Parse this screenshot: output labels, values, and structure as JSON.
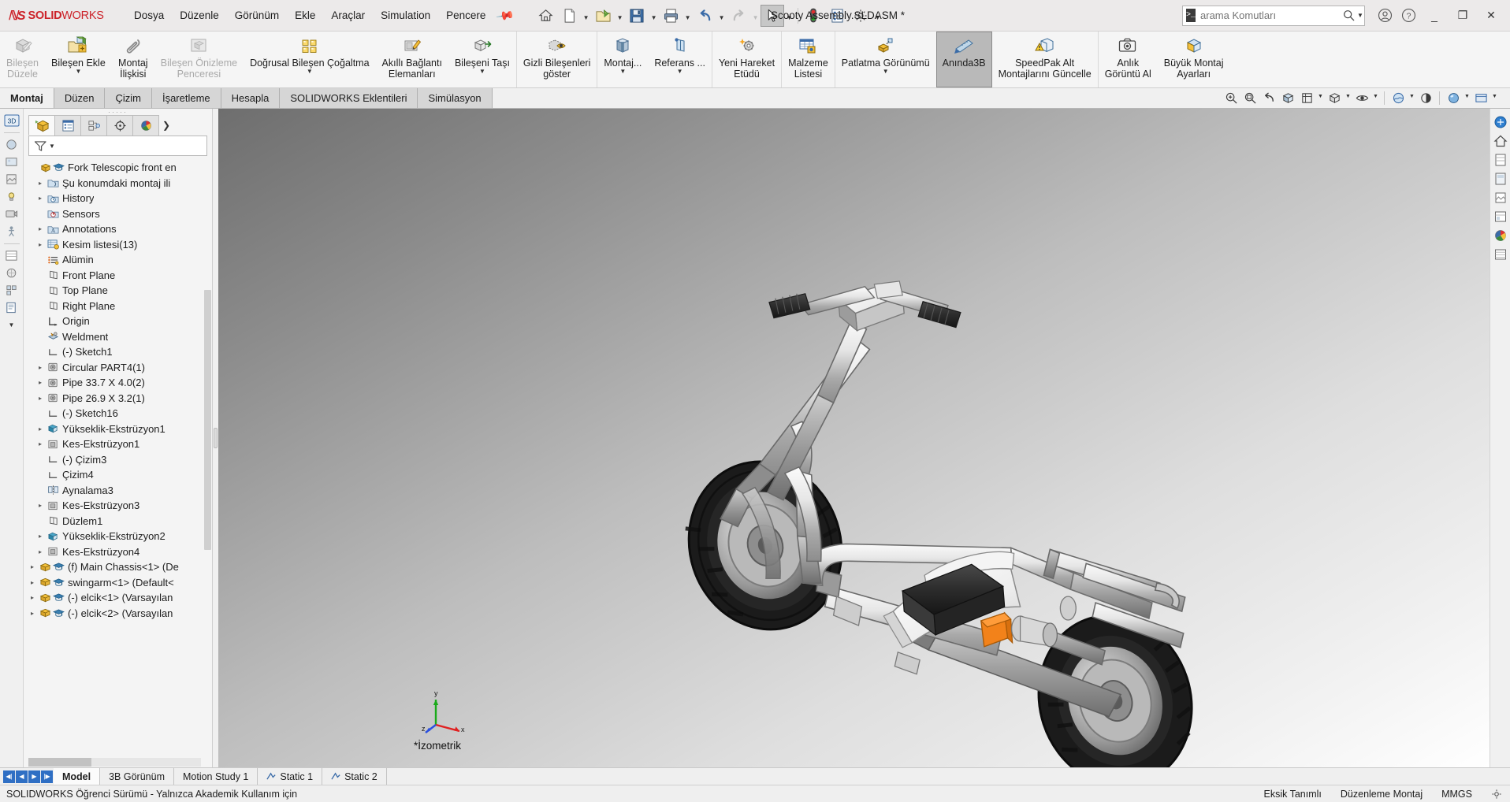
{
  "titlebar": {
    "brand_ds": "2S",
    "brand_solid": "SOLID",
    "brand_works": "WORKS",
    "menus": [
      "Dosya",
      "Düzenle",
      "Görünüm",
      "Ekle",
      "Araçlar",
      "Simulation",
      "Pencere"
    ],
    "pin_icon": "pin-icon",
    "quick_tools": [
      {
        "name": "home-icon"
      },
      {
        "name": "new-document-icon",
        "caret": true
      },
      {
        "name": "open-folder-icon",
        "caret": true
      },
      {
        "name": "save-icon",
        "caret": true
      },
      {
        "name": "print-icon",
        "caret": true
      },
      {
        "name": "undo-icon",
        "caret": true
      },
      {
        "name": "redo-icon",
        "caret": true,
        "disabled": true
      },
      {
        "name": "select-cursor-icon",
        "caret": true,
        "active": true
      },
      {
        "name": "rebuild-icon"
      },
      {
        "name": "file-properties-icon"
      },
      {
        "name": "options-gear-icon",
        "caret": true
      }
    ],
    "document_title": "Scooty Assembly.SLDASM *",
    "search_placeholder": "arama Komutları",
    "search_value": "",
    "account_icon": "user-account-icon",
    "help_icon": "help-question-icon",
    "minimize": "_",
    "restore": "❐",
    "close": "✕"
  },
  "ribbon": {
    "groups": [
      {
        "buttons": [
          {
            "label": "Bileşen\nDüzele",
            "icon": "edit-component-icon",
            "disabled": true,
            "caret": false
          },
          {
            "label": "Bileşen Ekle",
            "icon": "insert-component-icon",
            "disabled": false,
            "caret": true
          },
          {
            "label": "Montaj\nİlişkisi",
            "icon": "mate-paperclip-icon",
            "disabled": false,
            "caret": false
          },
          {
            "label": "Bileşen Önizleme\nPenceresi",
            "icon": "component-preview-icon",
            "disabled": true,
            "caret": false
          },
          {
            "label": "Doğrusal Bileşen Çoğaltma",
            "icon": "linear-pattern-icon",
            "disabled": false,
            "caret": true
          },
          {
            "label": "Akıllı Bağlantı\nElemanları",
            "icon": "smart-fasteners-icon",
            "disabled": false,
            "caret": false
          },
          {
            "label": "Bileşeni Taşı",
            "icon": "move-component-icon",
            "disabled": false,
            "caret": true
          }
        ]
      },
      {
        "buttons": [
          {
            "label": "Gizli Bileşenleri\ngöster",
            "icon": "show-hidden-components-icon",
            "disabled": false,
            "caret": false
          }
        ]
      },
      {
        "buttons": [
          {
            "label": "Montaj...",
            "icon": "assembly-features-icon",
            "disabled": false,
            "caret": true
          },
          {
            "label": "Referans ...",
            "icon": "reference-geometry-icon",
            "disabled": false,
            "caret": true
          }
        ]
      },
      {
        "buttons": [
          {
            "label": "Yeni Hareket\nEtüdü",
            "icon": "new-motion-study-icon",
            "disabled": false,
            "caret": false
          }
        ]
      },
      {
        "buttons": [
          {
            "label": "Malzeme\nListesi",
            "icon": "bill-of-materials-icon",
            "disabled": false,
            "caret": false
          }
        ]
      },
      {
        "buttons": [
          {
            "label": "Patlatma Görünümü",
            "icon": "exploded-view-icon",
            "disabled": false,
            "caret": true
          },
          {
            "label": "Anında3B",
            "icon": "instant3d-icon",
            "disabled": false,
            "caret": false,
            "selected": true
          },
          {
            "label": "SpeedPak Alt\nMontajlarını Güncelle",
            "icon": "speedpak-update-icon",
            "disabled": false,
            "caret": false
          }
        ]
      },
      {
        "buttons": [
          {
            "label": "Anlık\nGörüntü Al",
            "icon": "take-snapshot-camera-icon",
            "disabled": false,
            "caret": false
          },
          {
            "label": "Büyük Montaj\nAyarları",
            "icon": "large-assembly-settings-icon",
            "disabled": false,
            "caret": false
          }
        ]
      }
    ]
  },
  "tabs": {
    "items": [
      "Montaj",
      "Düzen",
      "Çizim",
      "İşaretleme",
      "Hesapla",
      "SOLIDWORKS Eklentileri",
      "Simülasyon"
    ],
    "active_index": 0
  },
  "view_toolbar": [
    {
      "name": "zoom-to-fit-icon",
      "caret": false
    },
    {
      "name": "zoom-area-icon",
      "caret": false
    },
    {
      "name": "previous-view-icon",
      "caret": false
    },
    {
      "name": "section-view-icon",
      "caret": false
    },
    {
      "name": "view-orientation-icon",
      "caret": false
    },
    {
      "name": "display-style-icon",
      "caret": true
    },
    {
      "name": "hide-show-items-icon",
      "caret": true
    },
    {
      "name": "apply-scene-icon",
      "caret": true
    },
    {
      "name": "view-settings-icon",
      "caret": false
    },
    {
      "name": "appearance-sphere-icon",
      "caret": true
    },
    {
      "name": "viewport-layout-icon",
      "caret": true
    }
  ],
  "left_rail": [
    {
      "name": "3d-views-icon",
      "label": "3D"
    },
    {
      "name": "appearance-icon"
    },
    {
      "name": "scene-icon"
    },
    {
      "name": "decal-icon"
    },
    {
      "name": "lights-icon"
    },
    {
      "name": "camera-icon"
    },
    {
      "name": "walk-through-icon"
    },
    {
      "name": "display-manager-icon"
    },
    {
      "name": "render-tools-icon"
    },
    {
      "name": "configuration-icon"
    },
    {
      "name": "custom-properties-icon",
      "caret": true
    }
  ],
  "feature_manager": {
    "tabs": [
      {
        "name": "feature-manager-tree-tab",
        "active": true
      },
      {
        "name": "property-manager-tab",
        "active": false
      },
      {
        "name": "configuration-manager-tab",
        "active": false
      },
      {
        "name": "dimxpert-manager-tab",
        "active": false
      },
      {
        "name": "display-manager-tab",
        "active": false
      }
    ],
    "more_tabs_icon": "chevron-right-icon",
    "filter_icon": "filter-funnel-icon",
    "filter_placeholder": "",
    "tree": [
      {
        "indent": 0,
        "arrow": false,
        "icon": "assembly-root-icon",
        "icon2": "graduate-cap-icon",
        "label": "Fork Telescopic front en"
      },
      {
        "indent": 1,
        "arrow": true,
        "icon": "mates-folder-icon",
        "label": "Şu konumdaki montaj ili"
      },
      {
        "indent": 1,
        "arrow": true,
        "icon": "history-icon",
        "label": "History"
      },
      {
        "indent": 1,
        "arrow": false,
        "icon": "sensors-icon",
        "label": "Sensors"
      },
      {
        "indent": 1,
        "arrow": true,
        "icon": "annotations-icon",
        "label": "Annotations"
      },
      {
        "indent": 1,
        "arrow": true,
        "icon": "cut-list-icon",
        "label": "Kesim listesi(13)"
      },
      {
        "indent": 1,
        "arrow": false,
        "icon": "material-icon",
        "label": "Alümin"
      },
      {
        "indent": 1,
        "arrow": false,
        "icon": "plane-icon",
        "label": "Front Plane"
      },
      {
        "indent": 1,
        "arrow": false,
        "icon": "plane-icon",
        "label": "Top Plane"
      },
      {
        "indent": 1,
        "arrow": false,
        "icon": "plane-icon",
        "label": "Right Plane"
      },
      {
        "indent": 1,
        "arrow": false,
        "icon": "origin-icon",
        "label": "Origin"
      },
      {
        "indent": 1,
        "arrow": false,
        "icon": "weldment-icon",
        "label": "Weldment"
      },
      {
        "indent": 1,
        "arrow": false,
        "icon": "sketch-icon",
        "label": "(-) Sketch1"
      },
      {
        "indent": 1,
        "arrow": true,
        "icon": "structural-member-icon",
        "label": "Circular PART4(1)"
      },
      {
        "indent": 1,
        "arrow": true,
        "icon": "structural-member-icon",
        "label": "Pipe 33.7 X 4.0(2)"
      },
      {
        "indent": 1,
        "arrow": true,
        "icon": "structural-member-icon",
        "label": "Pipe 26.9 X 3.2(1)"
      },
      {
        "indent": 1,
        "arrow": false,
        "icon": "sketch-icon",
        "label": "(-) Sketch16"
      },
      {
        "indent": 1,
        "arrow": true,
        "icon": "extrude-boss-icon",
        "label": "Yükseklik-Ekstrüzyon1"
      },
      {
        "indent": 1,
        "arrow": true,
        "icon": "extrude-cut-icon",
        "label": "Kes-Ekstrüzyon1"
      },
      {
        "indent": 1,
        "arrow": false,
        "icon": "sketch-icon",
        "label": "(-) Çizim3"
      },
      {
        "indent": 1,
        "arrow": false,
        "icon": "sketch-icon",
        "label": "Çizim4"
      },
      {
        "indent": 1,
        "arrow": false,
        "icon": "mirror-icon",
        "label": "Aynalama3"
      },
      {
        "indent": 1,
        "arrow": true,
        "icon": "extrude-cut-icon",
        "label": "Kes-Ekstrüzyon3"
      },
      {
        "indent": 1,
        "arrow": false,
        "icon": "plane-icon",
        "label": "Düzlem1"
      },
      {
        "indent": 1,
        "arrow": true,
        "icon": "extrude-boss-icon",
        "label": "Yükseklik-Ekstrüzyon2"
      },
      {
        "indent": 1,
        "arrow": true,
        "icon": "extrude-cut-icon",
        "label": "Kes-Ekstrüzyon4"
      },
      {
        "indent": 0,
        "arrow": true,
        "icon": "component-icon",
        "icon2": "graduate-cap-icon",
        "label": "(f) Main Chassis<1> (De"
      },
      {
        "indent": 0,
        "arrow": true,
        "icon": "component-icon",
        "icon2": "graduate-cap-icon",
        "label": "swingarm<1> (Default<"
      },
      {
        "indent": 0,
        "arrow": true,
        "icon": "component-icon",
        "icon2": "graduate-cap-icon",
        "label": "(-) elcik<1> (Varsayılan"
      },
      {
        "indent": 0,
        "arrow": true,
        "icon": "component-icon",
        "icon2": "graduate-cap-icon",
        "label": "(-) elcik<2> (Varsayılan"
      }
    ]
  },
  "graphics": {
    "view_label": "*İzometrik",
    "triad_axes": [
      "x",
      "y",
      "z"
    ],
    "model_description": "3D isometric view of a welded-tube scooter assembly with front fork, handlebars, two knobby wheels, white body panels and an orange linkage block"
  },
  "right_rail": [
    {
      "name": "view-orientation-cube-icon"
    },
    {
      "name": "home-view-icon"
    },
    {
      "name": "appearance-panel-icon"
    },
    {
      "name": "scene-panel-icon"
    },
    {
      "name": "decal-panel-icon"
    },
    {
      "name": "light-panel-icon"
    },
    {
      "name": "color-wheel-icon"
    },
    {
      "name": "display-pane-icon"
    }
  ],
  "bottom_tabs": {
    "nav_buttons": [
      "first-tab-icon",
      "prev-tab-icon",
      "next-tab-icon",
      "last-tab-icon"
    ],
    "items": [
      {
        "label": "Model",
        "icon": "",
        "active": true
      },
      {
        "label": "3B Görünüm",
        "icon": "",
        "active": false
      },
      {
        "label": "Motion Study 1",
        "icon": "",
        "active": false
      },
      {
        "label": "Static 1",
        "icon": "static-study-icon",
        "active": false
      },
      {
        "label": "Static 2",
        "icon": "static-study-icon",
        "active": false
      }
    ]
  },
  "statusbar": {
    "license": "SOLIDWORKS Öğrenci Sürümü - Yalnızca Akademik Kullanım için",
    "underdefined": "Eksik Tanımlı",
    "edit_state": "Düzenleme Montaj",
    "units": "MMGS",
    "customize_icon": "customize-units-icon"
  }
}
